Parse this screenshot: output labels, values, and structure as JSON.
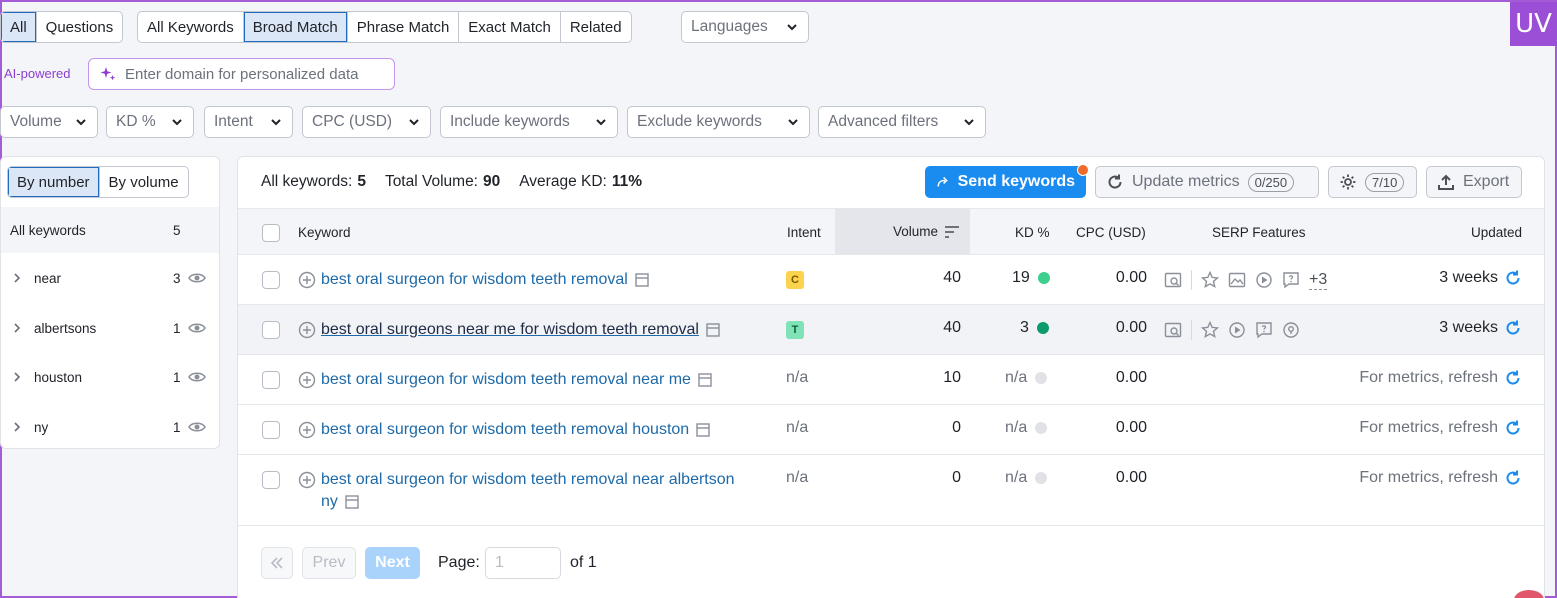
{
  "tabs": {
    "group1": [
      "All",
      "Questions"
    ],
    "group2": [
      "All Keywords",
      "Broad Match",
      "Phrase Match",
      "Exact Match",
      "Related"
    ],
    "languages": "Languages"
  },
  "ai": {
    "label": "AI-powered",
    "placeholder": "Enter domain for personalized data"
  },
  "filters": [
    "Volume",
    "KD %",
    "Intent",
    "CPC (USD)",
    "Include keywords",
    "Exclude keywords",
    "Advanced filters"
  ],
  "logo": "UV",
  "sidebar": {
    "by_number": "By number",
    "by_volume": "By volume",
    "all_label": "All keywords",
    "all_count": "5",
    "groups": [
      {
        "name": "near",
        "count": "3"
      },
      {
        "name": "albertsons",
        "count": "1"
      },
      {
        "name": "houston",
        "count": "1"
      },
      {
        "name": "ny",
        "count": "1"
      }
    ]
  },
  "summary": {
    "all_label": "All keywords:",
    "all_value": "5",
    "volume_label": "Total Volume:",
    "volume_value": "90",
    "kd_label": "Average KD:",
    "kd_value": "11%"
  },
  "actions": {
    "send": "Send keywords",
    "update": "Update metrics",
    "update_count": "0/250",
    "settings_count": "7/10",
    "export": "Export"
  },
  "columns": {
    "keyword": "Keyword",
    "intent": "Intent",
    "volume": "Volume",
    "kd": "KD %",
    "cpc": "CPC (USD)",
    "serp": "SERP Features",
    "updated": "Updated"
  },
  "rows": [
    {
      "keyword": "best oral surgeon for wisdom teeth removal",
      "intent": "C",
      "volume": "40",
      "kd": "19",
      "cpc": "0.00",
      "serp_more": "+3",
      "updated": "3 weeks"
    },
    {
      "keyword": "best oral surgeons near me for wisdom teeth removal",
      "intent": "T",
      "volume": "40",
      "kd": "3",
      "cpc": "0.00",
      "updated": "3 weeks"
    },
    {
      "keyword": "best oral surgeon for wisdom teeth removal near me",
      "intent": "n/a",
      "volume": "10",
      "kd": "n/a",
      "cpc": "0.00",
      "updated": "For metrics, refresh"
    },
    {
      "keyword": "best oral surgeon for wisdom teeth removal houston",
      "intent": "n/a",
      "volume": "0",
      "kd": "n/a",
      "cpc": "0.00",
      "updated": "For metrics, refresh"
    },
    {
      "keyword_line1": "best oral surgeon for wisdom teeth removal near albertson",
      "keyword_line2": "ny",
      "intent": "n/a",
      "volume": "0",
      "kd": "n/a",
      "cpc": "0.00",
      "updated": "For metrics, refresh"
    }
  ],
  "pager": {
    "prev": "Prev",
    "next": "Next",
    "page_label": "Page:",
    "page_value": "1",
    "of": "of 1"
  },
  "colors": {
    "accent": "#1a8cf0",
    "kd_green": "#3ccf8e",
    "kd_dark_green": "#0e9a6a",
    "kd_na": "#e0e2e6",
    "intent_c": "#fcd34d",
    "intent_t": "#7fe3b5",
    "ai": "#8c3ed0"
  }
}
